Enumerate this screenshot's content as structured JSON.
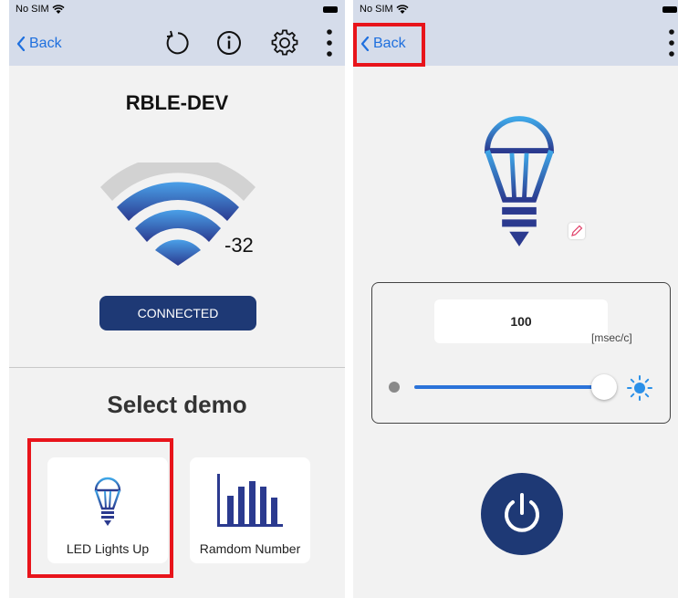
{
  "status": {
    "carrier": "No SIM"
  },
  "left_screen": {
    "nav": {
      "back_label": "Back",
      "icons": [
        "refresh-icon",
        "info-icon",
        "gear-icon",
        "more-vertical-icon"
      ]
    },
    "device_name": "RBLE-DEV",
    "rssi": "-32",
    "connection_status": "CONNECTED",
    "select_demo_title": "Select demo",
    "demos": [
      {
        "label": "LED Lights Up",
        "icon": "light-bulb-icon"
      },
      {
        "label": "Ramdom Number",
        "icon": "bar-chart-icon"
      }
    ]
  },
  "right_screen": {
    "nav": {
      "back_label": "Back",
      "icons": [
        "more-vertical-icon"
      ]
    },
    "interval_value": "100",
    "interval_unit": "[msec/c]",
    "slider_level": 1.0,
    "icons": [
      "light-bulb-icon",
      "edit-icon",
      "brightness-icon",
      "power-icon"
    ]
  },
  "colors": {
    "nav_bg": "#d5dcea",
    "accent_blue": "#1e6fde",
    "button_navy": "#1e3975",
    "highlight_red": "#e8141b"
  }
}
